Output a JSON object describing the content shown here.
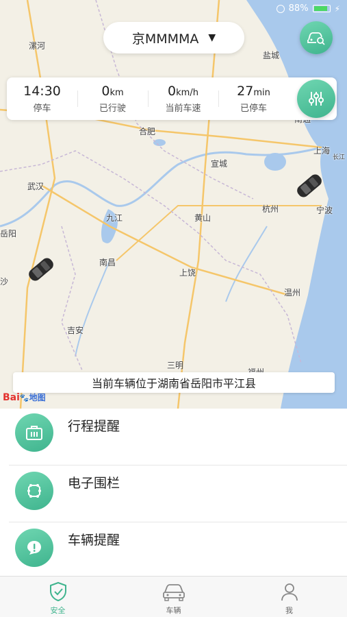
{
  "status_bar": {
    "battery": "88%"
  },
  "vehicle_selector": {
    "plate": "京MMMMA",
    "caret": "▼"
  },
  "stats": [
    {
      "value": "14:30",
      "unit": "",
      "label": "停车"
    },
    {
      "value": "0",
      "unit": "km",
      "label": "已行驶"
    },
    {
      "value": "0",
      "unit": "km/h",
      "label": "当前车速"
    },
    {
      "value": "27",
      "unit": "min",
      "label": "已停车"
    }
  ],
  "map": {
    "cities": [
      "漯河",
      "盐城",
      "合肥",
      "南通",
      "上海",
      "宣城",
      "长江",
      "武汉",
      "杭州",
      "宁波",
      "九江",
      "黄山",
      "岳阳",
      "南昌",
      "上饶",
      "沙",
      "温州",
      "吉安",
      "三明",
      "福州"
    ],
    "location_text": "当前车辆位于湖南省岳阳市平江县",
    "logo_text": "Bai",
    "logo_map": "地图"
  },
  "menu": {
    "items": [
      {
        "label": "行程提醒",
        "icon": "briefcase-icon"
      },
      {
        "label": "电子围栏",
        "icon": "fence-icon"
      },
      {
        "label": "车辆提醒",
        "icon": "alert-bubble-icon"
      }
    ]
  },
  "tabs": [
    {
      "label": "安全",
      "icon": "shield-icon",
      "active": true
    },
    {
      "label": "车辆",
      "icon": "car-icon",
      "active": false
    },
    {
      "label": "我",
      "icon": "user-icon",
      "active": false
    }
  ],
  "colors": {
    "accent": "#3fb48e",
    "map_water": "#a9c9ec",
    "map_land": "#f3f0e6"
  }
}
